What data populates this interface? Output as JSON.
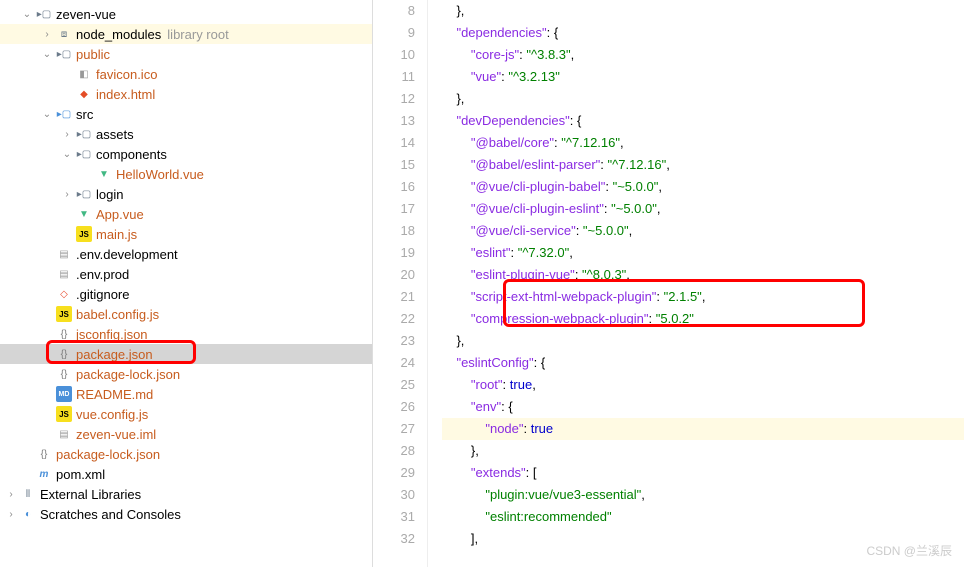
{
  "tree": {
    "root": {
      "name": "zeven-vue"
    },
    "node_modules": {
      "name": "node_modules",
      "tag": "library root"
    },
    "public": {
      "name": "public"
    },
    "favicon": {
      "name": "favicon.ico"
    },
    "indexhtml": {
      "name": "index.html"
    },
    "src": {
      "name": "src"
    },
    "assets": {
      "name": "assets"
    },
    "components": {
      "name": "components"
    },
    "helloworld": {
      "name": "HelloWorld.vue"
    },
    "login": {
      "name": "login"
    },
    "appvue": {
      "name": "App.vue"
    },
    "mainjs": {
      "name": "main.js"
    },
    "envdev": {
      "name": ".env.development"
    },
    "envprod": {
      "name": ".env.prod"
    },
    "gitignore": {
      "name": ".gitignore"
    },
    "babelcfg": {
      "name": "babel.config.js"
    },
    "jsconfig": {
      "name": "jsconfig.json"
    },
    "packagejson": {
      "name": "package.json"
    },
    "packagelock2": {
      "name": "package-lock.json"
    },
    "readme": {
      "name": "README.md"
    },
    "vuecfg": {
      "name": "vue.config.js"
    },
    "zeveniml": {
      "name": "zeven-vue.iml"
    },
    "packagelock": {
      "name": "package-lock.json"
    },
    "pom": {
      "name": "pom.xml"
    },
    "extlib": {
      "name": "External Libraries"
    },
    "scratch": {
      "name": "Scratches and Consoles"
    }
  },
  "code": {
    "lines": [
      {
        "n": "8",
        "indent": 2,
        "raw": "},",
        "type": "plain"
      },
      {
        "n": "9",
        "indent": 2,
        "key": "dependencies",
        "after": ": {",
        "type": "key"
      },
      {
        "n": "10",
        "indent": 4,
        "key": "core-js",
        "val": "^3.8.3",
        "comma": true,
        "type": "kv"
      },
      {
        "n": "11",
        "indent": 4,
        "key": "vue",
        "val": "^3.2.13",
        "comma": false,
        "type": "kv"
      },
      {
        "n": "12",
        "indent": 2,
        "raw": "},",
        "type": "plain"
      },
      {
        "n": "13",
        "indent": 2,
        "key": "devDependencies",
        "after": ": {",
        "type": "key"
      },
      {
        "n": "14",
        "indent": 4,
        "key": "@babel/core",
        "val": "^7.12.16",
        "comma": true,
        "type": "kv"
      },
      {
        "n": "15",
        "indent": 4,
        "key": "@babel/eslint-parser",
        "val": "^7.12.16",
        "comma": true,
        "type": "kv"
      },
      {
        "n": "16",
        "indent": 4,
        "key": "@vue/cli-plugin-babel",
        "val": "~5.0.0",
        "comma": true,
        "type": "kv"
      },
      {
        "n": "17",
        "indent": 4,
        "key": "@vue/cli-plugin-eslint",
        "val": "~5.0.0",
        "comma": true,
        "type": "kv"
      },
      {
        "n": "18",
        "indent": 4,
        "key": "@vue/cli-service",
        "val": "~5.0.0",
        "comma": true,
        "type": "kv"
      },
      {
        "n": "19",
        "indent": 4,
        "key": "eslint",
        "val": "^7.32.0",
        "comma": true,
        "type": "kv"
      },
      {
        "n": "20",
        "indent": 4,
        "key": "eslint-plugin-vue",
        "val": "^8.0.3",
        "comma": true,
        "type": "kv"
      },
      {
        "n": "21",
        "indent": 4,
        "key": "script-ext-html-webpack-plugin",
        "val": "2.1.5",
        "comma": true,
        "type": "kv"
      },
      {
        "n": "22",
        "indent": 4,
        "key": "compression-webpack-plugin",
        "val": "5.0.2",
        "comma": false,
        "type": "kv"
      },
      {
        "n": "23",
        "indent": 2,
        "raw": "},",
        "type": "plain"
      },
      {
        "n": "24",
        "indent": 2,
        "key": "eslintConfig",
        "after": ": {",
        "type": "key"
      },
      {
        "n": "25",
        "indent": 4,
        "key": "root",
        "kw": "true",
        "comma": true,
        "type": "kkw"
      },
      {
        "n": "26",
        "indent": 4,
        "key": "env",
        "after": ": {",
        "type": "key"
      },
      {
        "n": "27",
        "indent": 6,
        "key": "node",
        "kw": "true",
        "comma": false,
        "type": "kkw",
        "hl": true
      },
      {
        "n": "28",
        "indent": 4,
        "raw": "},",
        "type": "plain"
      },
      {
        "n": "29",
        "indent": 4,
        "key": "extends",
        "after": ": [",
        "type": "key"
      },
      {
        "n": "30",
        "indent": 6,
        "val": "plugin:vue/vue3-essential",
        "comma": true,
        "type": "val"
      },
      {
        "n": "31",
        "indent": 6,
        "val": "eslint:recommended",
        "comma": false,
        "type": "val"
      },
      {
        "n": "32",
        "indent": 4,
        "raw": "],",
        "type": "plain"
      }
    ]
  },
  "watermark": "CSDN @兰溪辰"
}
